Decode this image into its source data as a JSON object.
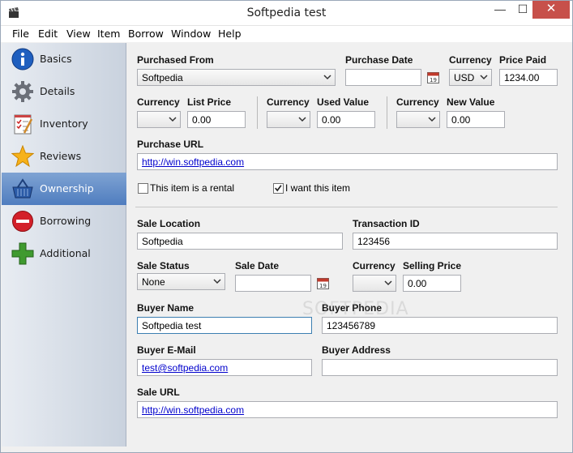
{
  "window": {
    "title": "Softpedia test"
  },
  "menu": [
    "File",
    "Edit",
    "View",
    "Item",
    "Borrow",
    "Window",
    "Help"
  ],
  "sidebar": {
    "items": [
      {
        "label": "Basics",
        "icon": "info-icon"
      },
      {
        "label": "Details",
        "icon": "gear-icon"
      },
      {
        "label": "Inventory",
        "icon": "checklist-icon"
      },
      {
        "label": "Reviews",
        "icon": "star-icon"
      },
      {
        "label": "Ownership",
        "icon": "basket-icon",
        "active": true
      },
      {
        "label": "Borrowing",
        "icon": "no-entry-icon"
      },
      {
        "label": "Additional",
        "icon": "plus-icon"
      }
    ]
  },
  "purchase": {
    "purchased_from_label": "Purchased From",
    "purchased_from_value": "Softpedia",
    "purchase_date_label": "Purchase Date",
    "purchase_date_value": "",
    "currency_label": "Currency",
    "currency_value": "USD",
    "price_paid_label": "Price Paid",
    "price_paid_value": "1234.00"
  },
  "values": {
    "currency_label": "Currency",
    "list_price_label": "List Price",
    "list_price_value": "0.00",
    "used_value_label": "Used Value",
    "used_value_value": "0.00",
    "new_value_label": "New Value",
    "new_value_value": "0.00"
  },
  "purchase_url": {
    "label": "Purchase URL",
    "value": "http://win.softpedia.com"
  },
  "checks": {
    "rental_label": "This item is a rental",
    "rental_checked": false,
    "want_label": "I want this item",
    "want_checked": true
  },
  "sale": {
    "location_label": "Sale Location",
    "location_value": "Softpedia",
    "transaction_label": "Transaction ID",
    "transaction_value": "123456",
    "status_label": "Sale Status",
    "status_value": "None",
    "date_label": "Sale Date",
    "date_value": "",
    "currency_label": "Currency",
    "currency_value": "",
    "price_label": "Selling Price",
    "price_value": "0.00"
  },
  "buyer": {
    "name_label": "Buyer Name",
    "name_value": "Softpedia test",
    "phone_label": "Buyer Phone",
    "phone_value": "123456789",
    "email_label": "Buyer E-Mail",
    "email_value": "test@softpedia.com",
    "address_label": "Buyer Address",
    "address_value": ""
  },
  "sale_url": {
    "label": "Sale URL",
    "value": "http://win.softpedia.com"
  },
  "watermark": "SOFTPEDIA"
}
